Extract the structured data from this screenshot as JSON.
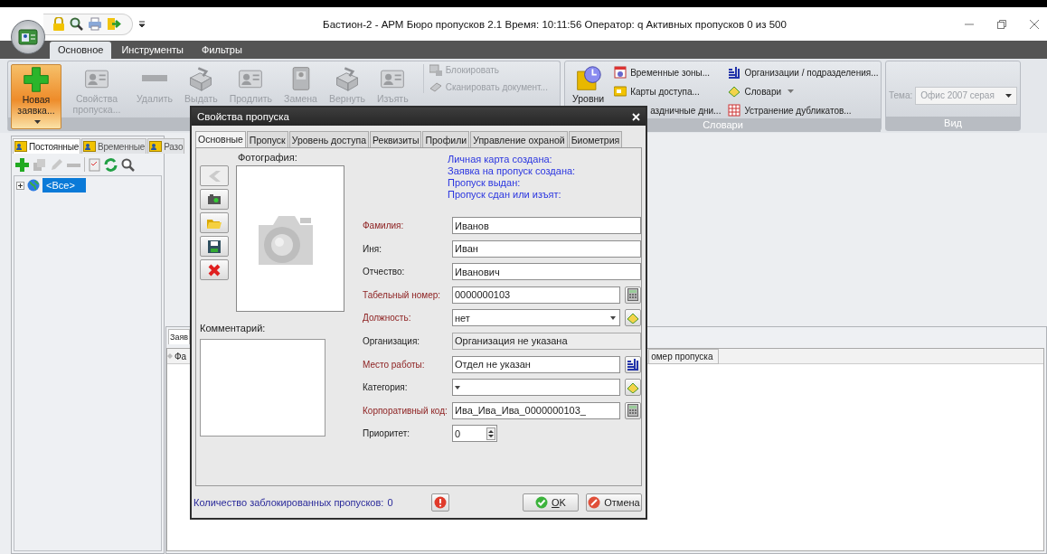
{
  "window": {
    "title": "Бастион-2 - АРМ Бюро пропусков 2.1 Время: 10:11:56 Оператор: q  Активных пропусков 0 из 500"
  },
  "ribbon_tabs": [
    {
      "label": "Основное",
      "selected": true
    },
    {
      "label": "Инструменты",
      "selected": false
    },
    {
      "label": "Фильтры",
      "selected": false
    }
  ],
  "ribbon": {
    "main_group": {
      "large_buttons": [
        {
          "label": "Новая заявка...",
          "disabled": false,
          "dropdown": true
        },
        {
          "label": "Свойства пропуска...",
          "disabled": true,
          "dropdown": false
        },
        {
          "label": "Удалить",
          "disabled": true,
          "dropdown": false
        },
        {
          "label": "Выдать",
          "disabled": true,
          "dropdown": false
        },
        {
          "label": "Продлить",
          "disabled": true,
          "dropdown": false
        },
        {
          "label": "Замена",
          "disabled": true,
          "dropdown": false
        },
        {
          "label": "Вернуть",
          "disabled": true,
          "dropdown": false
        },
        {
          "label": "Изъять",
          "disabled": true,
          "dropdown": false
        }
      ],
      "small_buttons": [
        {
          "label": "Блокировать",
          "disabled": true
        },
        {
          "label": "Сканировать документ...",
          "disabled": true
        }
      ]
    },
    "dictionaries_group": {
      "title": "Словари",
      "large_button": {
        "label": "Уровни"
      },
      "items": [
        {
          "label": "Временные зоны...",
          "dropdown": false
        },
        {
          "label": "Карты доступа...",
          "dropdown": false
        },
        {
          "label": "аздничные дни...",
          "dropdown": false
        },
        {
          "label": "Организации / подразделения...",
          "dropdown": false
        },
        {
          "label": "Словари",
          "dropdown": true
        },
        {
          "label": "Устранение дубликатов...",
          "dropdown": false
        }
      ]
    },
    "view_group": {
      "title": "Вид",
      "theme_label": "Тема:",
      "theme_value": "Офис 2007 серая",
      "disabled": true
    }
  },
  "left_panel": {
    "tabs": [
      {
        "label": "Постоянные",
        "selected": true
      },
      {
        "label": "Временные",
        "selected": false
      },
      {
        "label": "Разо",
        "selected": false
      }
    ],
    "tree": [
      {
        "label": "<Все>",
        "selected": true,
        "expanded": false
      }
    ]
  },
  "lower_panel": {
    "tabs": [
      {
        "label": "Заяв",
        "selected": true
      }
    ],
    "columns": [
      "Фа",
      "омер пропуска"
    ]
  },
  "dialog": {
    "title": "Свойства пропуска",
    "tabs": [
      {
        "label": "Основные",
        "selected": true
      },
      {
        "label": "Пропуск",
        "selected": false
      },
      {
        "label": "Уровень доступа",
        "selected": false
      },
      {
        "label": "Реквизиты",
        "selected": false
      },
      {
        "label": "Профили",
        "selected": false
      },
      {
        "label": "Управление охраной",
        "selected": false
      },
      {
        "label": "Биометрия",
        "selected": false
      }
    ],
    "photo_label": "Фотография:",
    "photo_buttons": [
      {
        "disabled": true
      },
      {
        "disabled": false
      },
      {
        "disabled": false
      },
      {
        "disabled": false
      },
      {
        "disabled": false
      }
    ],
    "status_lines": [
      "Личная карта создана:",
      "Заявка на пропуск создана:",
      "Пропуск выдан:",
      "Пропуск сдан или изъят:"
    ],
    "comment_label": "Комментарий:",
    "fields": [
      {
        "label": "Фамилия:",
        "value": "Иванов",
        "kind": "text",
        "required": true
      },
      {
        "label": "Иня:",
        "value": "Иван",
        "kind": "text",
        "required": false
      },
      {
        "label": "Отчество:",
        "value": "Иванович",
        "kind": "text",
        "required": false
      },
      {
        "label": "Табельный номер:",
        "value": "0000000103",
        "kind": "text",
        "required": true
      },
      {
        "label": "Должность:",
        "value": "нет",
        "kind": "combo",
        "required": true
      },
      {
        "label": "Организация:",
        "value": "Организация не указана",
        "kind": "readonly",
        "required": false
      },
      {
        "label": "Место работы:",
        "value": "Отдел не указан",
        "kind": "text",
        "required": true
      },
      {
        "label": "Категория:",
        "kind": "combo",
        "required": false
      },
      {
        "label": "Корпоративный код:",
        "value": "Ива_Ива_Ива_0000000103_",
        "kind": "text",
        "required": true
      },
      {
        "label": "Приоритет:",
        "value": "0",
        "kind": "spin",
        "required": false
      }
    ],
    "blocked_label": "Количество заблокированных пропусков:",
    "blocked_count": "0",
    "ok": "OK",
    "cancel": "Отмена"
  }
}
